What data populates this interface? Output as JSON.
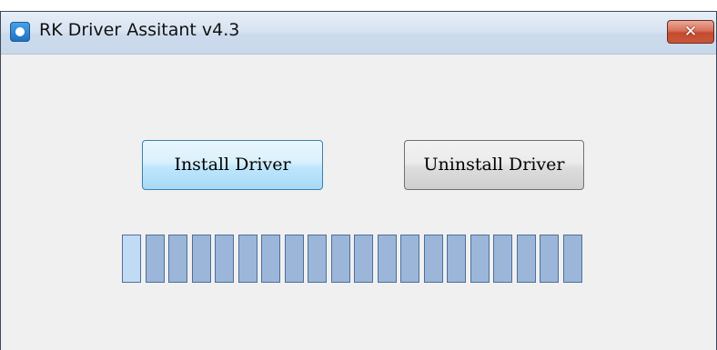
{
  "window": {
    "title": "RK Driver Assitant v4.3",
    "close_glyph": "✕"
  },
  "buttons": {
    "install_label": "Install Driver",
    "uninstall_label": "Uninstall Driver"
  },
  "progress": {
    "segment_count": 20,
    "active_segments": 1,
    "colors": {
      "active": "#c2dbf5",
      "idle": "#9bb6d8",
      "border": "#4d6f9c"
    }
  },
  "icons": {
    "app": "app-logo-icon",
    "close": "close-icon"
  }
}
